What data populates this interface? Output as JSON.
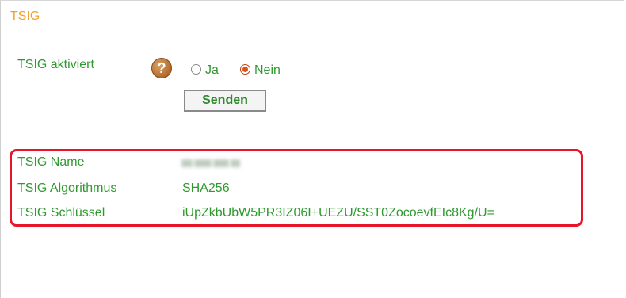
{
  "section": {
    "title": "TSIG"
  },
  "tsig_toggle": {
    "label": "TSIG aktiviert",
    "help_glyph": "?",
    "option_yes": "Ja",
    "option_no": "Nein",
    "selected": "Nein",
    "submit_label": "Senden"
  },
  "details": {
    "name_label": "TSIG Name",
    "name_value": "",
    "algorithm_label": "TSIG Algorithmus",
    "algorithm_value": "SHA256",
    "key_label": "TSIG Schlüssel",
    "key_value": "iUpZkbUbW5PR3IZ06I+UEZU/SST0ZocoevfEIc8Kg/U="
  },
  "colors": {
    "section_title": "#f0a030",
    "text": "#2e9a2e",
    "highlight": "#e8152a",
    "radio_selected": "#e0501a"
  },
  "icons": {
    "help": "question-mark-circle-icon"
  }
}
